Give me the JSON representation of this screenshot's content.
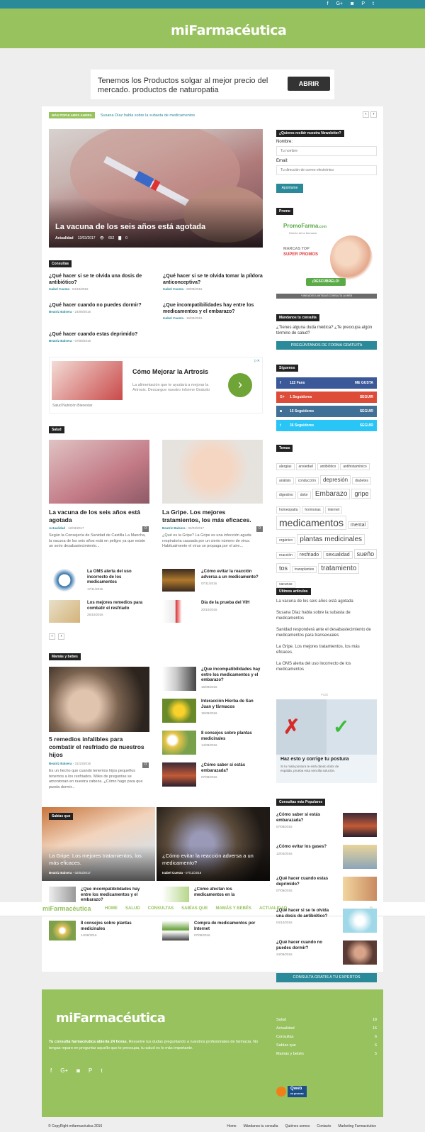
{
  "topbar": {
    "icons": [
      "facebook-icon",
      "googleplus-icon",
      "instagram-icon",
      "pinterest-icon",
      "twitter-icon"
    ],
    "glyphs": [
      "f",
      "G+",
      "◙",
      "P",
      "t"
    ]
  },
  "brand": {
    "name": "miFarmacéutica"
  },
  "ad_top": {
    "text": "Tenemos los Productos solgar al mejor precio del mercado. productos de naturopatia",
    "button": "ABRIR"
  },
  "ticker": {
    "label": "MÁS POPULARES AHORA",
    "text": "Susana Díaz habla sobre la subasta de medicamentos",
    "prev": "‹",
    "next": "›"
  },
  "hero": {
    "title": "La vacuna de los seis años está agotada",
    "category": "Actualidad",
    "date": "12/03/2017",
    "views": "652",
    "comments": "0"
  },
  "consultas": {
    "heading": "Consultas",
    "items": [
      {
        "title": "¿Qué hacer si se te olvida una dosis de antibiótico?",
        "author": "Isabel Cuesta",
        "date": "04/10/2016"
      },
      {
        "title": "¿Qué hacer si se te olvida tomar la píldora anticonceptiva?",
        "author": "Isabel Cuesta",
        "date": "29/09/2016"
      },
      {
        "title": "¿Qué hacer cuando no puedes dormir?",
        "author": "Beatriz Balsera",
        "date": "24/09/2016"
      },
      {
        "title": "¿Que incompatibilidades hay entre los medicamentos y el embarazo?",
        "author": "Isabel Cuesta",
        "date": "16/09/2016"
      },
      {
        "title": "¿Qué hacer cuando estas deprimido?",
        "author": "Beatriz Balsera",
        "date": "07/09/2016"
      }
    ]
  },
  "ad_mid": {
    "title": "Cómo Mejorar la Artrosis",
    "text": "La alimentación que te ayudará a mejorar la Artrosis. Descargue nuestro informe Gratuito",
    "source": "Salud Nutrición Bienestar",
    "arrow": "›",
    "adchoice": "▷✕"
  },
  "salud": {
    "heading": "Salud",
    "big": [
      {
        "title": "La vacuna de los seis años está agotada",
        "author": "Actualidad",
        "date": "12/03/2017",
        "comments": "0",
        "excerpt": "Según la Consejería de Sanidad de Castilla La Mancha, la vacuna de los seis años está en peligro ya que existe un serio desabastecimiento..."
      },
      {
        "title": "La Gripe. Los mejores tratamientos, los más eficaces.",
        "author": "Beatriz Balsera",
        "date": "02/03/2017",
        "comments": "0",
        "excerpt": "¿Qué es la Gripe? La Gripe es una infección aguda respiratoria causada por un cierto número de virus. Habitualmente el virus se propaga por el aire..."
      }
    ],
    "small": [
      {
        "title": "La OMS alerta del uso incorrecto de los medicamentos",
        "date": "17/11/2016"
      },
      {
        "title": "¿Cómo evitar la reacción adversa a un medicamento?",
        "date": "07/11/2016"
      },
      {
        "title": "Los mejores remedios para combatir el resfriado",
        "date": "25/10/2016"
      },
      {
        "title": "Día de la prueba del VIH",
        "date": "20/10/2016"
      }
    ],
    "pager": [
      "‹",
      "›"
    ]
  },
  "mamas": {
    "heading": "Mamás y bebes",
    "big": {
      "title": "5 remedios infalibles para combatir el resfriado de nuestros hijos",
      "author": "Beatriz Balsera",
      "date": "31/10/2016",
      "comments": "0",
      "excerpt": "Es un hecho que cuando tenemos hijos pequeños tenemos a los resfriados. Miles de preguntas se amontonan en nuestra cabeza. ¿Cómo hago para que pueda dormir..."
    },
    "small": [
      {
        "title": "¿Que incompatibilidades hay entre los medicamentos y el embarazo?",
        "date": "16/09/2016"
      },
      {
        "title": "Interacción Hierba de San Juan y fármacos",
        "date": "15/09/2016"
      },
      {
        "title": "8 consejos sobre plantas medicinales",
        "date": "14/08/2016"
      },
      {
        "title": "¿Cómo saber si estás embarazada?",
        "date": "07/08/2016"
      }
    ]
  },
  "sabias": {
    "heading": "Sabías que",
    "big": [
      {
        "title": "La Gripe. Los mejores tratamientos, los más eficaces.",
        "author": "Beatriz Balsera",
        "date": "02/03/2017"
      },
      {
        "title": "¿Cómo evitar la reacción adversa a un medicamento?",
        "author": "Isabel Cuesta",
        "date": "07/11/2016"
      }
    ],
    "small": [
      {
        "title": "¿Que incompatibilidades hay entre los medicamentos y el embarazo?",
        "date": ""
      },
      {
        "title": "¿Cómo afectan los medicamentos en la",
        "date": ""
      },
      {
        "title": "8 consejos sobre plantas medicinales",
        "date": "14/08/2016"
      },
      {
        "title": "Compra de medicamentos por Internet",
        "date": "07/08/2016"
      }
    ]
  },
  "nav": {
    "items": [
      "HOME",
      "SALUD",
      "CONSULTAS",
      "SABÍAS QUE",
      "MAMÁS Y BEBÉS",
      "ACTUALIDAD"
    ],
    "search": "⌕"
  },
  "sidebar": {
    "newsletter": {
      "heading": "¿Quieres recibir nuestra Newsletter?",
      "name_label": "Nombre:",
      "name_placeholder": "Tu nombre",
      "email_label": "Email:",
      "email_placeholder": "Tu dirección de correo electrónico",
      "button": "Apúntame"
    },
    "promo": {
      "heading": "Promo",
      "brand": "PromoFarma",
      "brand_tld": ".com",
      "sub": "Directo de la farmacia",
      "line1": "MARCAS TOP",
      "line2": "SUPER PROMOS",
      "cta": "¡DESCÚBRELO!",
      "note": "*UNIDADES LIMITADAS CONSULTA LA WEB"
    },
    "consulta": {
      "heading": "Mándanos tu consulta",
      "text": "¿Tienes alguna duda médica? ¿Te preocupa algún término de salud?",
      "button": "PREGÚNTANOS DE FORMA GRATUITA"
    },
    "siguenos": {
      "heading": "Síguenos",
      "rows": [
        {
          "icon": "f",
          "count": "122",
          "unit": "Fans",
          "action": "ME GUSTA",
          "color": "#3b5998"
        },
        {
          "icon": "G+",
          "count": "1",
          "unit": "Seguidores",
          "action": "SEGUIR",
          "color": "#dd4b39"
        },
        {
          "icon": "◙",
          "count": "15",
          "unit": "Seguidores",
          "action": "SEGUIR",
          "color": "#417096"
        },
        {
          "icon": "t",
          "count": "36",
          "unit": "Seguidores",
          "action": "SEGUIR",
          "color": "#29c5f6"
        }
      ]
    },
    "temas": {
      "heading": "Temas",
      "tags": [
        "alergias",
        "ansiedad",
        "antibiótico",
        "antihistamínico",
        "análisis",
        "conducción",
        "depresión",
        "diabetes",
        "digestivo",
        "dolor",
        "Embarazo",
        "gripe",
        "homeopatía",
        "hormonas",
        "internet",
        "medicamentos",
        "mental",
        "orgánico",
        "plantas medicinales",
        "reacción",
        "resfriado",
        "sexualidad",
        "sueño",
        "tos",
        "transplantes",
        "tratamiento",
        "vacunas"
      ]
    },
    "ultimos": {
      "heading": "Últimos artículos",
      "items": [
        "La vacuna de los seis años está agotada",
        "Susana Díaz habla sobre la subasta de medicamentos",
        "Sanidad responderá ante el desabastecimiento de medicamentos para transexuales",
        "La Gripe. Los mejores tratamientos, los más eficaces.",
        "La OMS alerta del uso incorrecto de los medicamentos"
      ]
    },
    "ad_side": {
      "label": "Publi",
      "title": "Haz esto y corrige tu postura",
      "text": "Si tu mala postura te está dando dolor de espalda, prueba esta sencilla solución."
    },
    "populares": {
      "heading": "Consultas más Populares",
      "items": [
        {
          "title": "¿Cómo saber si estás embarazada?",
          "date": "07/08/2016"
        },
        {
          "title": "¿Cómo evitar los gases?",
          "date": "12/04/2016"
        },
        {
          "title": "¿Qué hacer cuando estas deprimido?",
          "date": "07/09/2016"
        },
        {
          "title": "¿Qué hacer si se te olvida una dosis de antibiótico?",
          "date": "04/10/2016"
        },
        {
          "title": "¿Qué hacer cuando no puedes dormir?",
          "date": "24/09/2016"
        }
      ],
      "button": "CONSULTA GRATIS A TU EXPERTOS"
    }
  },
  "footer": {
    "text_bold": "Tu consulta farmacéutica abierta 24 horas.",
    "text": " Resuelve tus dudas preguntando a nuestros profesionales de farmacia. No tengas reparo en preguntar aquello que te preocupa, tu salud es lo más importante.",
    "cats": [
      {
        "name": "Salud",
        "count": "18"
      },
      {
        "name": "Actualidad",
        "count": "16"
      },
      {
        "name": "Consultas",
        "count": "6"
      },
      {
        "name": "Sabías que",
        "count": "6"
      },
      {
        "name": "Mamás y bebés",
        "count": "5"
      }
    ],
    "badge": "Qweb",
    "badge_sub": "en proceso"
  },
  "bottom": {
    "copyright": "© CopyRight mifarmacéutica 2016",
    "links": [
      "Home",
      "Mándanos tu consulta",
      "Quiénes somos",
      "Contacto",
      "Marketing Farmacéutico"
    ]
  }
}
